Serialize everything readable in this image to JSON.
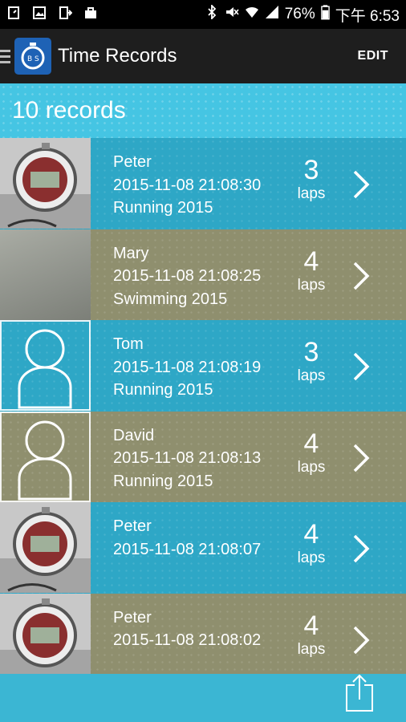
{
  "status_bar": {
    "battery": "76%",
    "time": "下午 6:53"
  },
  "action_bar": {
    "title": "Time Records",
    "edit_label": "EDIT"
  },
  "header": {
    "count_text": "10 records"
  },
  "records": [
    {
      "name": "Peter",
      "datetime": "2015-11-08 21:08:30",
      "event": "Running 2015",
      "laps": "3",
      "laps_label": "laps",
      "thumb": "stopwatch-photo",
      "color": "blue"
    },
    {
      "name": "Mary",
      "datetime": "2015-11-08 21:08:25",
      "event": "Swimming 2015",
      "laps": "4",
      "laps_label": "laps",
      "thumb": "blurred-photo",
      "color": "olive"
    },
    {
      "name": "Tom",
      "datetime": "2015-11-08 21:08:19",
      "event": "Running 2015",
      "laps": "3",
      "laps_label": "laps",
      "thumb": "default-avatar",
      "color": "blue"
    },
    {
      "name": "David",
      "datetime": "2015-11-08 21:08:13",
      "event": "Running 2015",
      "laps": "4",
      "laps_label": "laps",
      "thumb": "default-avatar",
      "color": "olive"
    },
    {
      "name": "Peter",
      "datetime": "2015-11-08 21:08:07",
      "event": "",
      "laps": "4",
      "laps_label": "laps",
      "thumb": "stopwatch-photo",
      "color": "blue"
    },
    {
      "name": "Peter",
      "datetime": "2015-11-08 21:08:02",
      "event": "",
      "laps": "4",
      "laps_label": "laps",
      "thumb": "stopwatch-photo",
      "color": "olive"
    }
  ],
  "colors": {
    "row_blue": "#2ea7c6",
    "row_olive": "#8f8f6e",
    "header": "#45c5e3",
    "action_bar": "#1e1e1e"
  }
}
